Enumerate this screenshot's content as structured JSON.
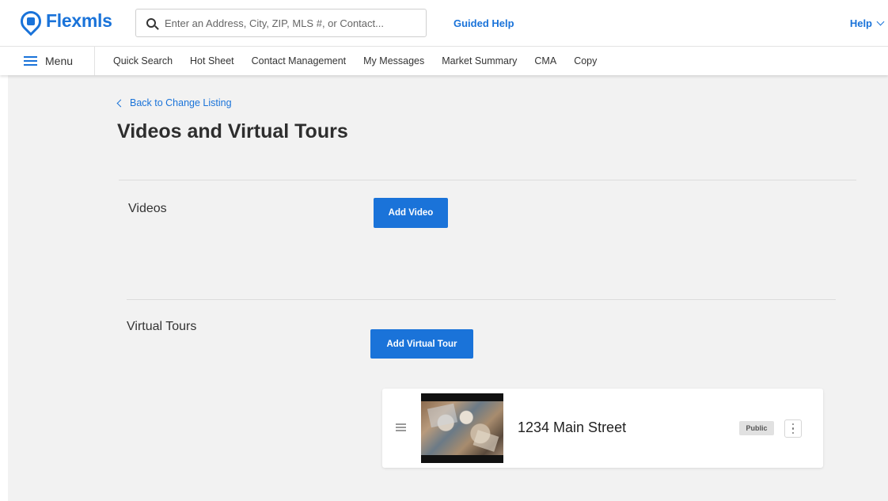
{
  "header": {
    "logo_text": "Flexmls",
    "search_placeholder": "Enter an Address, City, ZIP, MLS #, or Contact...",
    "guided_help": "Guided Help",
    "help": "Help"
  },
  "nav": {
    "menu_label": "Menu",
    "items": [
      "Quick Search",
      "Hot Sheet",
      "Contact Management",
      "My Messages",
      "Market Summary",
      "CMA",
      "Copy"
    ]
  },
  "page": {
    "back_link": "Back to Change Listing",
    "title": "Videos and Virtual Tours"
  },
  "videos": {
    "label": "Videos",
    "add_button": "Add Video"
  },
  "virtual_tours": {
    "label": "Virtual Tours",
    "add_button": "Add Virtual Tour",
    "items": [
      {
        "title": "1234 Main Street",
        "badge": "Public"
      }
    ]
  },
  "colors": {
    "accent": "#1a73d9",
    "page_background": "#f2f2f2",
    "badge_background": "#e1e1e1"
  }
}
